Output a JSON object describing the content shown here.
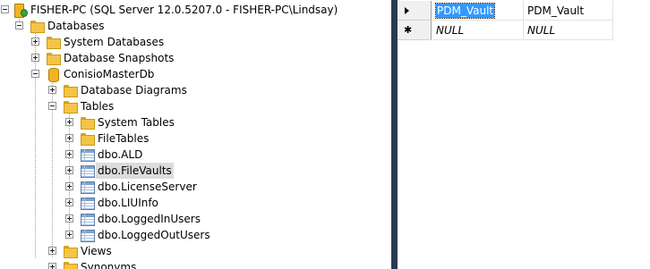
{
  "tree": {
    "server": "FISHER-PC (SQL Server 12.0.5207.0 - FISHER-PC\\Lindsay)",
    "databases": "Databases",
    "system_databases": "System Databases",
    "database_snapshots": "Database Snapshots",
    "conisio": "ConisioMasterDb",
    "database_diagrams": "Database Diagrams",
    "tables": "Tables",
    "system_tables": "System Tables",
    "file_tables": "FileTables",
    "t_ald": "dbo.ALD",
    "t_filevaults": "dbo.FileVaults",
    "t_licenseserver": "dbo.LicenseServer",
    "t_liuinfo": "dbo.LIUInfo",
    "t_loggedinusers": "dbo.LoggedInUsers",
    "t_loggedoutusers": "dbo.LoggedOutUsers",
    "views": "Views",
    "synonyms": "Synonyms"
  },
  "grid": {
    "rows": [
      {
        "col1": "PDM_Vault",
        "col2": "PDM_Vault"
      },
      {
        "col1": "NULL",
        "col2": "NULL"
      }
    ]
  }
}
